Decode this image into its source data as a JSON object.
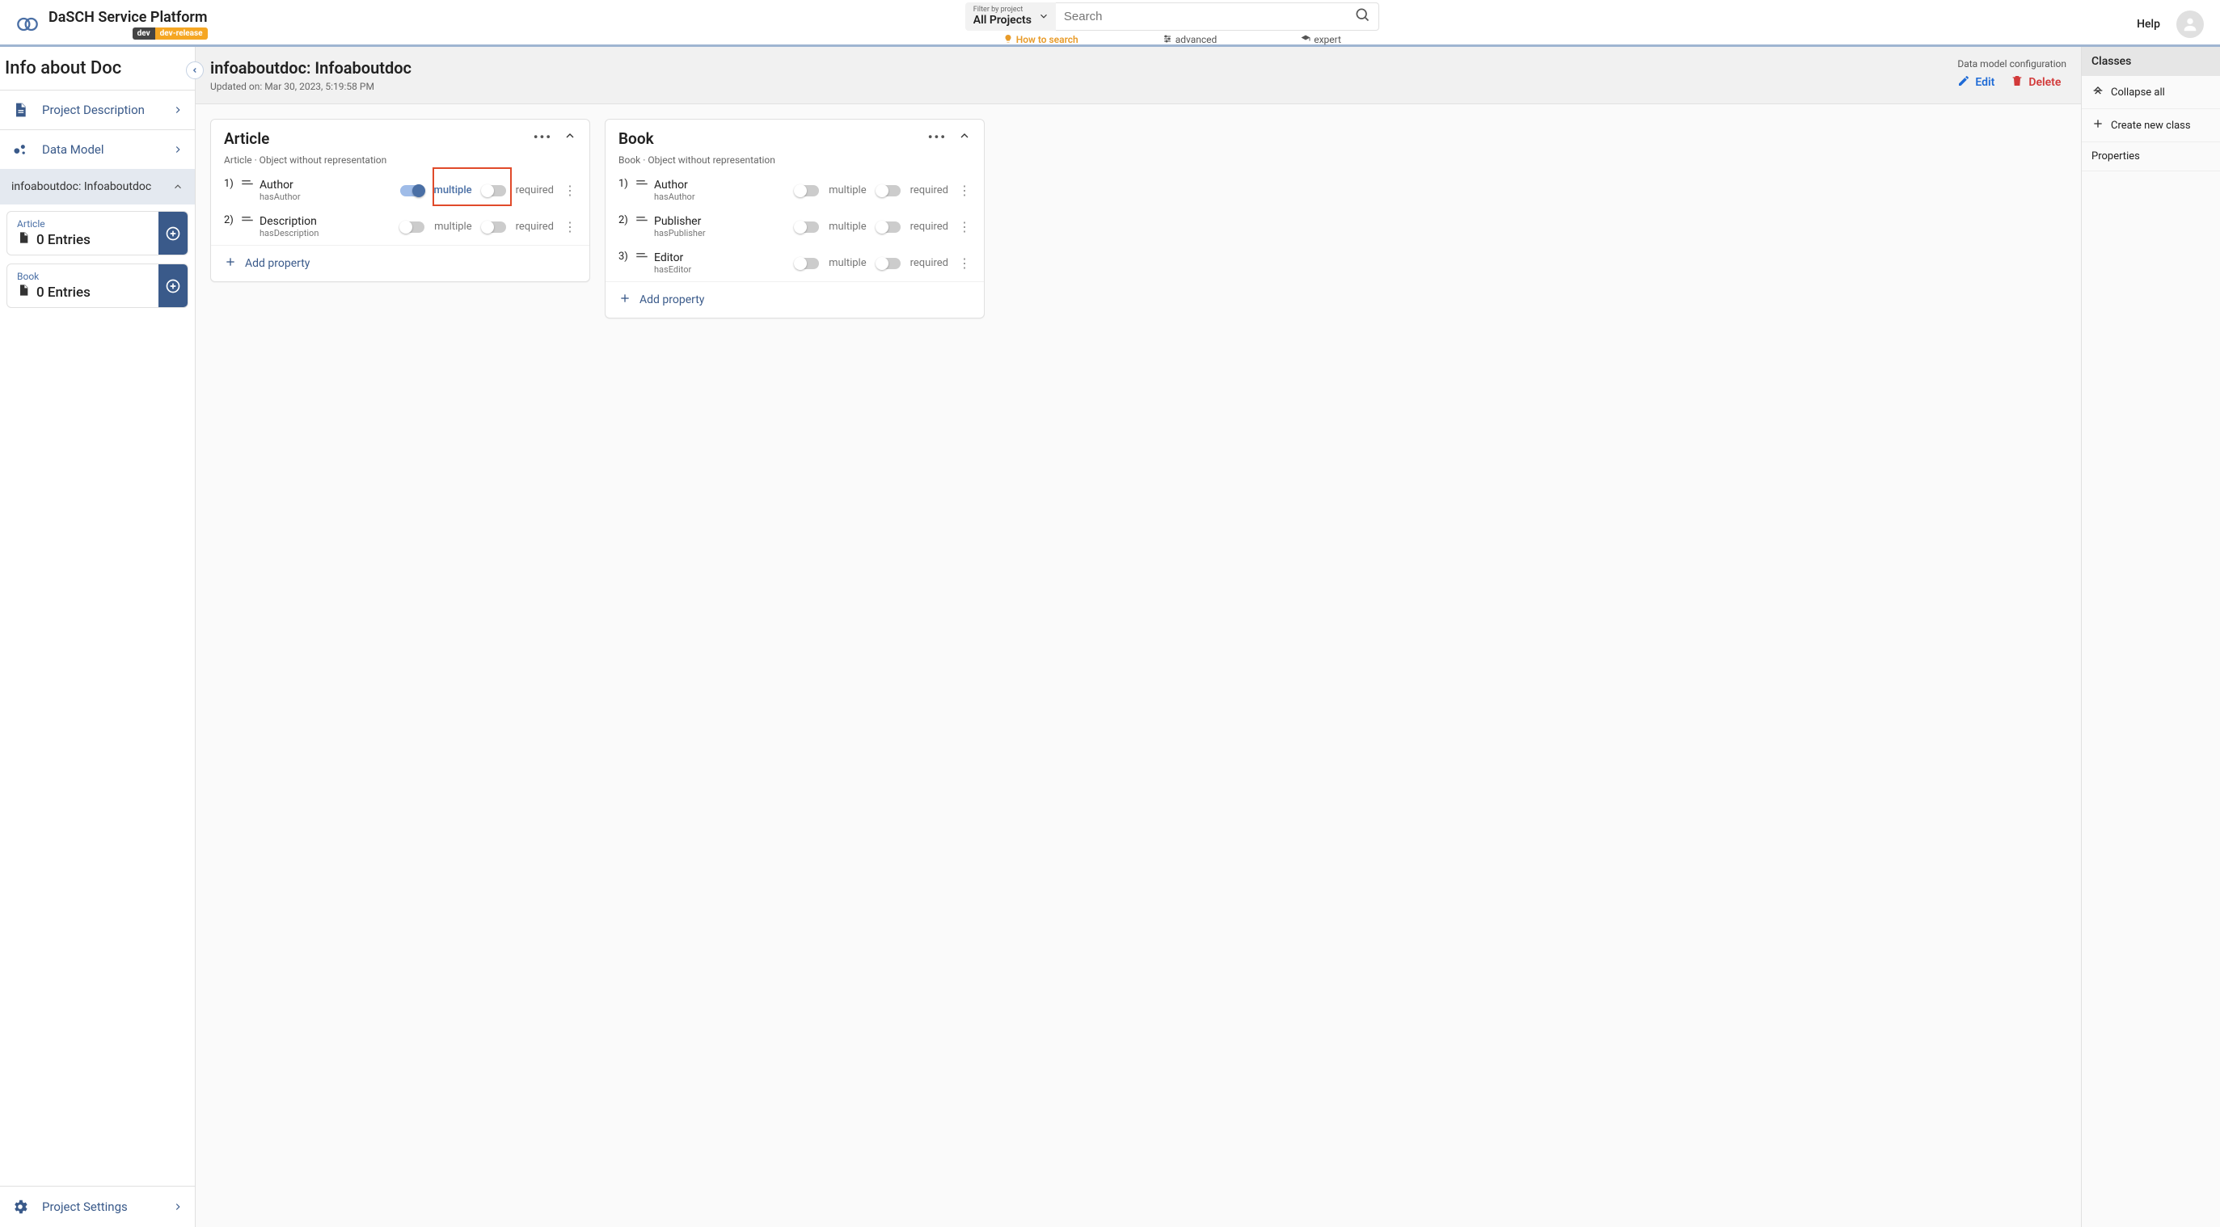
{
  "brand": {
    "title": "DaSCH Service Platform",
    "badge_dev": "dev",
    "badge_release": "dev-release"
  },
  "filter": {
    "label": "Filter by project",
    "value": "All Projects"
  },
  "search": {
    "placeholder": "Search",
    "link_howto": "How to search",
    "link_advanced": "advanced",
    "link_expert": "expert"
  },
  "help": "Help",
  "sidebar": {
    "title": "Info about Doc",
    "nav": {
      "project_description": "Project Description",
      "data_model": "Data Model",
      "ontology": "infoaboutdoc: Infoaboutdoc",
      "project_settings": "Project Settings"
    },
    "entries": [
      {
        "category": "Article",
        "count": "0 Entries"
      },
      {
        "category": "Book",
        "count": "0 Entries"
      }
    ]
  },
  "page": {
    "title": "infoaboutdoc: Infoaboutdoc",
    "updated": "Updated on: Mar 30, 2023, 5:19:58 PM",
    "config_label": "Data model configuration",
    "edit": "Edit",
    "delete": "Delete"
  },
  "classes": [
    {
      "name": "Article",
      "sub": "Article · Object without representation",
      "props": [
        {
          "idx": "1)",
          "name": "Author",
          "id": "hasAuthor",
          "multiple_on": true,
          "required_on": false,
          "highlight": true
        },
        {
          "idx": "2)",
          "name": "Description",
          "id": "hasDescription",
          "multiple_on": false,
          "required_on": false,
          "highlight": false
        }
      ]
    },
    {
      "name": "Book",
      "sub": "Book · Object without representation",
      "props": [
        {
          "idx": "1)",
          "name": "Author",
          "id": "hasAuthor",
          "multiple_on": false,
          "required_on": false,
          "highlight": false
        },
        {
          "idx": "2)",
          "name": "Publisher",
          "id": "hasPublisher",
          "multiple_on": false,
          "required_on": false,
          "highlight": false
        },
        {
          "idx": "3)",
          "name": "Editor",
          "id": "hasEditor",
          "multiple_on": false,
          "required_on": false,
          "highlight": false
        }
      ]
    }
  ],
  "labels": {
    "multiple": "multiple",
    "required": "required",
    "add_property": "Add property"
  },
  "rail": {
    "classes": "Classes",
    "collapse_all": "Collapse all",
    "create_class": "Create new class",
    "properties": "Properties"
  }
}
